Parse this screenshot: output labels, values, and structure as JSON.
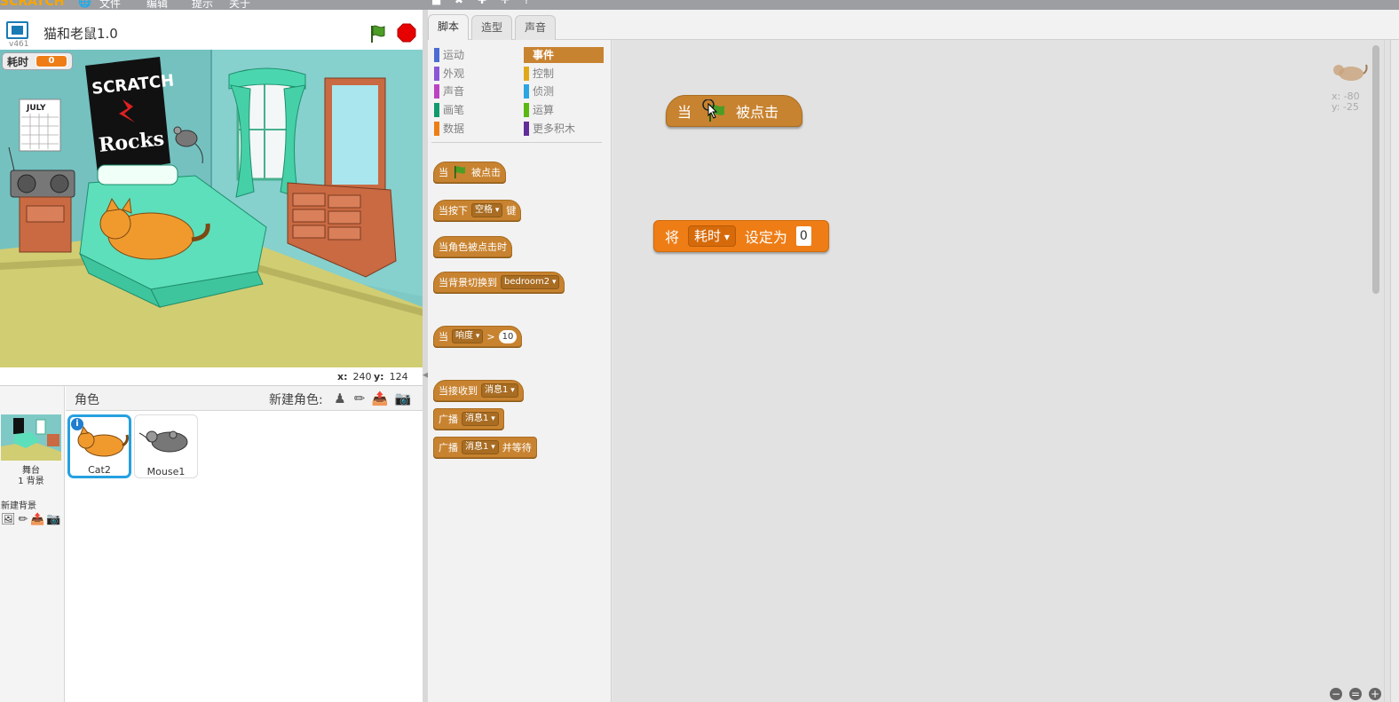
{
  "menubar": {
    "logo": "SCRATCH",
    "items": [
      "文件",
      "编辑",
      "提示",
      "关于"
    ]
  },
  "stage": {
    "version": "v461",
    "project_title": "猫和老鼠1.0",
    "monitor": {
      "label": "耗时",
      "value": "0"
    },
    "coords": {
      "x_label": "x:",
      "x": "240",
      "y_label": "y:",
      "y": "124"
    },
    "poster_text": [
      "SCRATCH",
      "Rocks"
    ],
    "calendar_text": "JULY"
  },
  "sprites": {
    "header": "角色",
    "new_sprite_label": "新建角色:",
    "stage_label": "舞台",
    "backdrop_count": "1 背景",
    "new_backdrop_label": "新建背景",
    "items": [
      {
        "name": "Cat2",
        "selected": true
      },
      {
        "name": "Mouse1",
        "selected": false
      }
    ]
  },
  "tabs": [
    {
      "label": "脚本",
      "active": true
    },
    {
      "label": "造型",
      "active": false
    },
    {
      "label": "声音",
      "active": false
    }
  ],
  "categories": {
    "left": [
      {
        "label": "运动",
        "color": "#4a6cd4"
      },
      {
        "label": "外观",
        "color": "#8a55d7"
      },
      {
        "label": "声音",
        "color": "#bb42c3"
      },
      {
        "label": "画笔",
        "color": "#0e9a6c"
      },
      {
        "label": "数据",
        "color": "#ee7d16"
      }
    ],
    "right": [
      {
        "label": "事件",
        "color": "#c88330",
        "active": true
      },
      {
        "label": "控制",
        "color": "#e1a91a"
      },
      {
        "label": "侦测",
        "color": "#2ca5e2"
      },
      {
        "label": "运算",
        "color": "#5cb712"
      },
      {
        "label": "更多积木",
        "color": "#632d99"
      }
    ]
  },
  "palette_blocks": {
    "when_flag": {
      "pre": "当",
      "post": "被点击"
    },
    "when_key": {
      "pre": "当按下",
      "key": "空格",
      "post": "键"
    },
    "when_sprite_clicked": {
      "text": "当角色被点击时"
    },
    "when_backdrop": {
      "pre": "当背景切换到",
      "value": "bedroom2"
    },
    "when_sensor": {
      "pre": "当",
      "sensor": "响度",
      "op": ">",
      "value": "10"
    },
    "when_receive": {
      "pre": "当接收到",
      "value": "消息1"
    },
    "broadcast": {
      "pre": "广播",
      "value": "消息1"
    },
    "broadcast_wait": {
      "pre": "广播",
      "value": "消息1",
      "post": "并等待"
    }
  },
  "script_blocks": {
    "when_flag": {
      "pre": "当",
      "post": "被点击"
    },
    "set_var": {
      "pre": "将",
      "var": "耗时",
      "mid": "设定为",
      "value": "0"
    }
  },
  "sprite_info": {
    "x": "x: -80",
    "y": "y: -25"
  }
}
